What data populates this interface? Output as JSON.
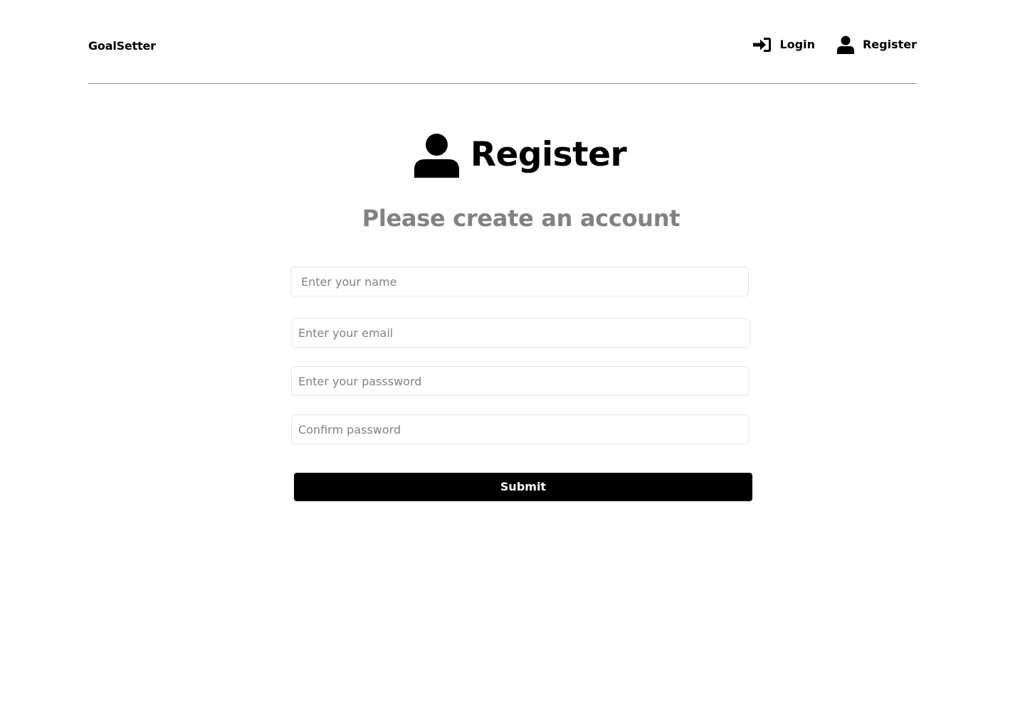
{
  "header": {
    "logo": "GoalSetter",
    "nav": [
      {
        "label": "Login",
        "icon": "sign-in-icon"
      },
      {
        "label": "Register",
        "icon": "user-icon"
      }
    ]
  },
  "main": {
    "heading": "Register",
    "heading_icon": "user-icon",
    "subtitle": "Please create an account"
  },
  "form": {
    "name_placeholder": "Enter your name",
    "email_placeholder": "Enter your email",
    "password_placeholder": "Enter your passsword",
    "confirm_placeholder": "Confirm password",
    "submit_label": "Submit"
  },
  "colors": {
    "text": "#000000",
    "muted": "#828282",
    "divider": "#8c8c8c",
    "input_border": "#e6e6e6",
    "button_bg": "#000000",
    "button_text": "#ffffff"
  }
}
